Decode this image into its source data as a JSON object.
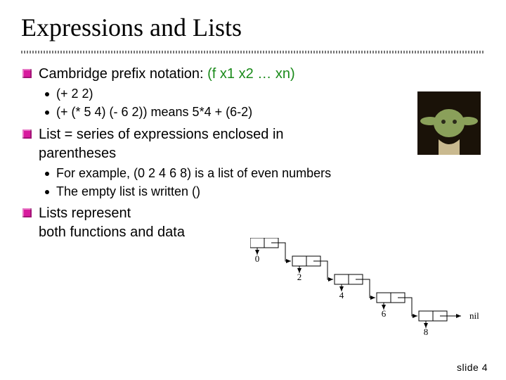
{
  "title": "Expressions and Lists",
  "bullets": {
    "b1": {
      "pre": "Cambridge prefix notation: ",
      "green": "(f x1 x2 … xn)"
    },
    "b1a": "(+ 2 2)",
    "b1b": "(+ (* 5 4) (- 6 2))  means  5*4 + (6-2)",
    "b2": "List = series of expressions enclosed in parentheses",
    "b2a": "For example, (0 2 4 6 8) is a list of even numbers",
    "b2b": "The empty list is written ()",
    "b3_line1": "Lists represent",
    "b3_line2": "both functions and data"
  },
  "diagram": {
    "values": [
      "0",
      "2",
      "4",
      "6",
      "8"
    ],
    "tail": "nil"
  },
  "footer": "slide 4"
}
